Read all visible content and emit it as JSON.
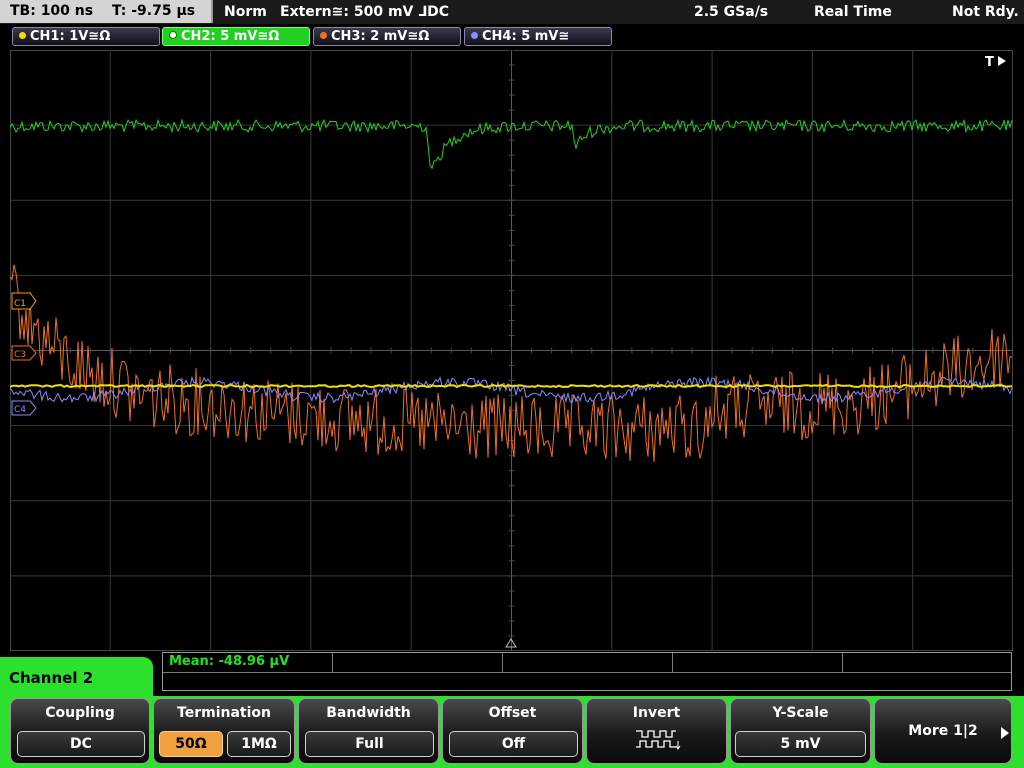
{
  "status": {
    "timebase": "TB: 100 ns",
    "trigger_time": "T: -9.75 µs",
    "mode": "Norm",
    "trigger_source": "Extern≅: 500 mV ⅃DC",
    "sample_rate": "2.5 GSa/s",
    "acq_mode": "Real Time",
    "state": "Not Rdy."
  },
  "channels": [
    {
      "label": "CH1: 1V≅Ω",
      "color": "#f0e000"
    },
    {
      "label": "CH2: 5 mV≅Ω",
      "color": "#22d022"
    },
    {
      "label": "CH3: 2 mV≅Ω",
      "color": "#f07020"
    },
    {
      "label": "CH4: 5 mV≅",
      "color": "#8a8aff"
    }
  ],
  "markers": {
    "c1": "C1",
    "c3": "C3",
    "c4": "C4",
    "trigger": "T"
  },
  "measurement": {
    "mean": "Mean: -48.96 µV"
  },
  "panel": {
    "channel_label": "Channel 2"
  },
  "softkeys": {
    "coupling": {
      "title": "Coupling",
      "value": "DC"
    },
    "termination": {
      "title": "Termination",
      "opt1": "50Ω",
      "opt2": "1MΩ"
    },
    "bandwidth": {
      "title": "Bandwidth",
      "value": "Full"
    },
    "offset": {
      "title": "Offset",
      "value": "Off"
    },
    "invert": {
      "title": "Invert"
    },
    "yscale": {
      "title": "Y-Scale",
      "value": "5 mV"
    },
    "more": {
      "title": "More 1|2"
    }
  },
  "colors": {
    "grid": "#555555",
    "ch1": "#f0e000",
    "ch2": "#22d022",
    "ch3": "#f07020",
    "ch4": "#8a8aff"
  }
}
